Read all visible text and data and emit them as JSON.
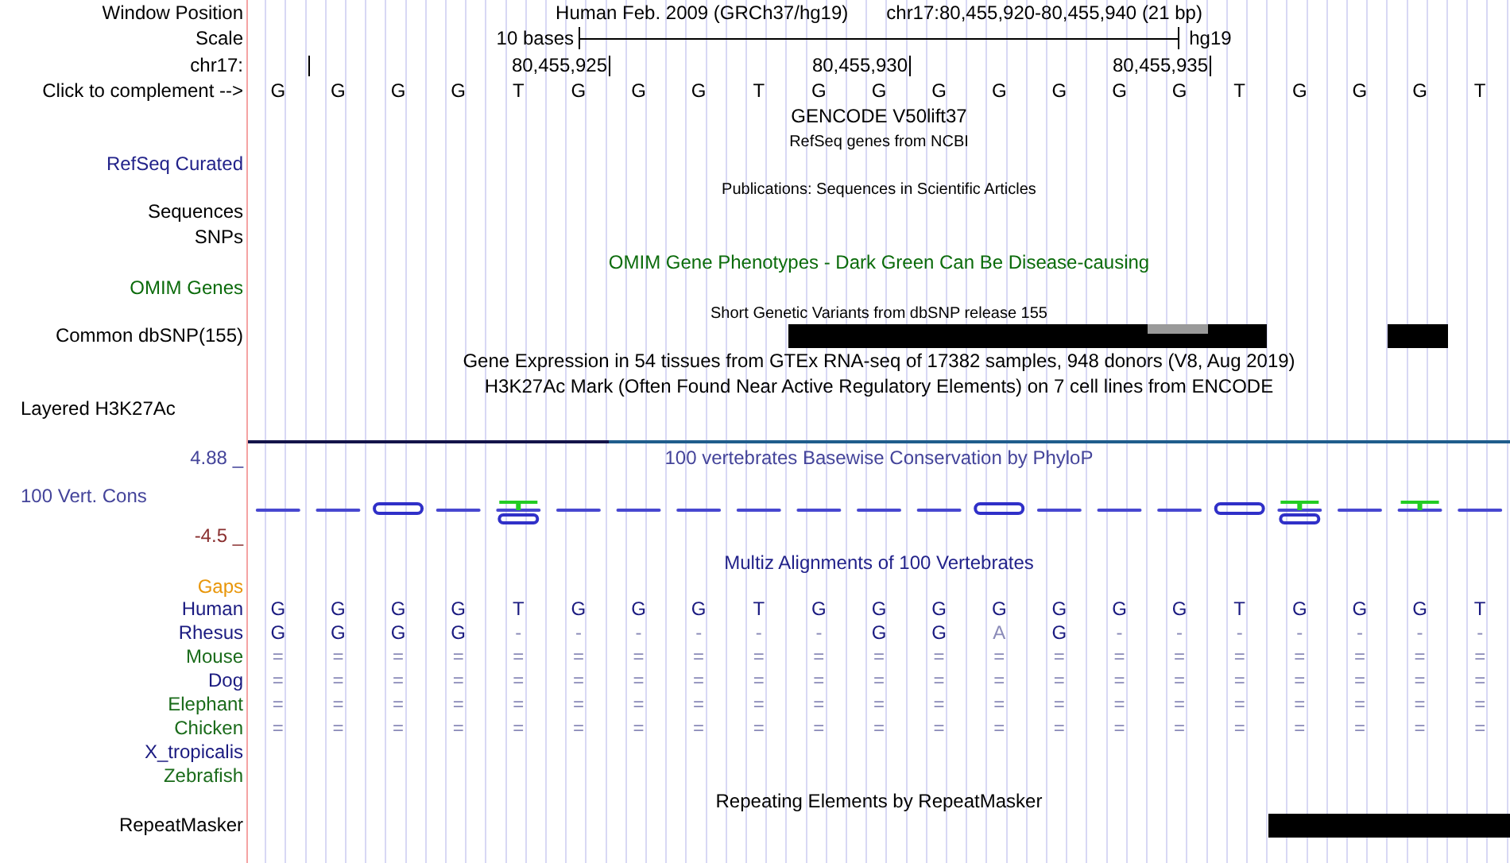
{
  "position": {
    "label": "Window Position",
    "assembly": "Human Feb. 2009 (GRCh37/hg19)",
    "range": "chr17:80,455,920-80,455,940 (21 bp)"
  },
  "scale": {
    "label": "Scale",
    "length": "10 bases",
    "assembly": "hg19"
  },
  "ruler": {
    "label": "chr17:",
    "ticks": [
      {
        "kind": "minor"
      },
      {
        "kind": "major",
        "text": "80,455,925"
      },
      {
        "kind": "major",
        "text": "80,455,930"
      },
      {
        "kind": "major",
        "text": "80,455,935"
      }
    ]
  },
  "sequence": {
    "label": "Click to complement -->",
    "bases": [
      "G",
      "G",
      "G",
      "G",
      "T",
      "G",
      "G",
      "G",
      "T",
      "G",
      "G",
      "G",
      "G",
      "G",
      "G",
      "G",
      "T",
      "G",
      "G",
      "G",
      "T"
    ]
  },
  "gencode": {
    "title": "GENCODE V50lift37"
  },
  "refseq": {
    "title": "RefSeq genes from NCBI",
    "label": "RefSeq Curated"
  },
  "publications": {
    "title": "Publications: Sequences in Scientific Articles",
    "label": "Sequences"
  },
  "snps": {
    "label": "SNPs"
  },
  "omim": {
    "title": "OMIM Gene Phenotypes - Dark Green Can Be Disease-causing",
    "label": "OMIM Genes"
  },
  "dbsnp": {
    "title": "Short Genetic Variants from dbSNP release 155",
    "label": "Common dbSNP(155)"
  },
  "gtex": {
    "title": "Gene Expression in 54 tissues from GTEx RNA-seq of 17382 samples, 948 donors (V8, Aug 2019)"
  },
  "h3k27ac": {
    "title": "H3K27Ac Mark (Often Found Near Active Regulatory Elements) on 7 cell lines from ENCODE",
    "label": "Layered H3K27Ac"
  },
  "phylop": {
    "title": "100 vertebrates Basewise Conservation by PhyloP",
    "label": "100 Vert. Cons",
    "max": "4.88 _",
    "min": "-4.5 _"
  },
  "multiz": {
    "title": "Multiz Alignments of 100 Vertebrates",
    "gaps_label": "Gaps",
    "species": [
      {
        "name": "Human",
        "color": "#1a1a80",
        "bases": [
          "G",
          "G",
          "G",
          "G",
          "T",
          "G",
          "G",
          "G",
          "T",
          "G",
          "G",
          "G",
          "G",
          "G",
          "G",
          "G",
          "T",
          "G",
          "G",
          "G",
          "T"
        ]
      },
      {
        "name": "Rhesus",
        "color": "#1a1a80",
        "bases": [
          "G",
          "G",
          "G",
          "G",
          "-",
          "-",
          "-",
          "-",
          "-",
          "-",
          "G",
          "G",
          {
            "text": "A",
            "mismatch": true
          },
          "G",
          "-",
          "-",
          "-",
          "-",
          "-",
          "-",
          "-"
        ]
      },
      {
        "name": "Mouse",
        "color": "#1a6b1a",
        "bases": [
          "=",
          "=",
          "=",
          "=",
          "=",
          "=",
          "=",
          "=",
          "=",
          "=",
          "=",
          "=",
          "=",
          "=",
          "=",
          "=",
          "=",
          "=",
          "=",
          "=",
          "="
        ]
      },
      {
        "name": "Dog",
        "color": "#1a1a80",
        "bases": [
          "=",
          "=",
          "=",
          "=",
          "=",
          "=",
          "=",
          "=",
          "=",
          "=",
          "=",
          "=",
          "=",
          "=",
          "=",
          "=",
          "=",
          "=",
          "=",
          "=",
          "="
        ]
      },
      {
        "name": "Elephant",
        "color": "#1a6b1a",
        "bases": [
          "=",
          "=",
          "=",
          "=",
          "=",
          "=",
          "=",
          "=",
          "=",
          "=",
          "=",
          "=",
          "=",
          "=",
          "=",
          "=",
          "=",
          "=",
          "=",
          "=",
          "="
        ]
      },
      {
        "name": "Chicken",
        "color": "#1a6b1a",
        "bases": [
          "=",
          "=",
          "=",
          "=",
          "=",
          "=",
          "=",
          "=",
          "=",
          "=",
          "=",
          "=",
          "=",
          "=",
          "=",
          "=",
          "=",
          "=",
          "=",
          "=",
          "="
        ]
      },
      {
        "name": "X_tropicalis",
        "color": "#1a1a80"
      },
      {
        "name": "Zebrafish",
        "color": "#1a6b1a"
      }
    ]
  },
  "repeatmasker": {
    "title": "Repeating Elements by RepeatMasker",
    "label": "RepeatMasker"
  }
}
